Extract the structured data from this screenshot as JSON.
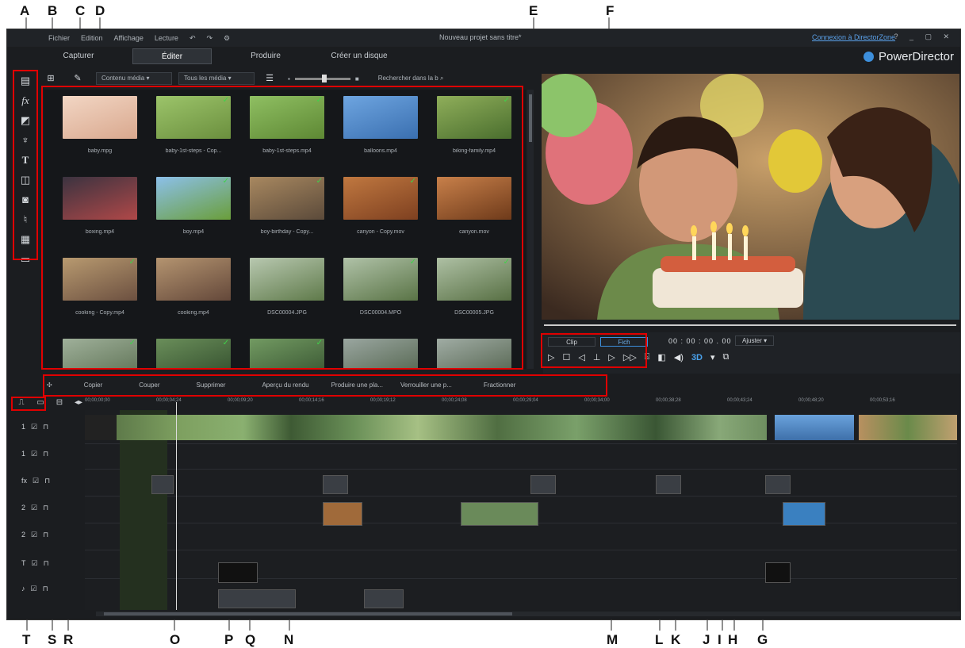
{
  "annotations_top": [
    "A",
    "B",
    "C",
    "D",
    "E",
    "F"
  ],
  "annotations_bottom": [
    "T",
    "S",
    "R",
    "O",
    "P",
    "Q",
    "N",
    "M",
    "L",
    "K",
    "J",
    "I",
    "H",
    "G"
  ],
  "menu": [
    "Fichier",
    "Edition",
    "Affichage",
    "Lecture"
  ],
  "project_title": "Nouveau projet sans titre*",
  "directorzone_link": "Connexion à DirectorZone",
  "window_controls": "? _ ▢ ✕",
  "mode_tabs": [
    "Capturer",
    "Éditer",
    "Produire",
    "Créer un disque"
  ],
  "brand": "PowerDirector",
  "library_bar": {
    "filter1": "Contenu média",
    "filter2": "Tous les média",
    "search_placeholder": "Rechercher dans la b"
  },
  "library_items": [
    {
      "name": "baby.mpg",
      "c1": "#f2d6c4",
      "c2": "#d9a88e",
      "check": false
    },
    {
      "name": "baby-1st-steps - Cop...",
      "c1": "#9cc46a",
      "c2": "#6b8f3e",
      "check": true
    },
    {
      "name": "baby-1st-steps.mp4",
      "c1": "#8fbf62",
      "c2": "#5e8834",
      "check": true
    },
    {
      "name": "balloons.mp4",
      "c1": "#6ea5e0",
      "c2": "#3a6fb0",
      "check": false
    },
    {
      "name": "biking-family.mp4",
      "c1": "#8fae5a",
      "c2": "#4a6e2e",
      "check": true
    },
    {
      "name": "boxing.mp4",
      "c1": "#3b3340",
      "c2": "#b04848",
      "check": false
    },
    {
      "name": "boy.mp4",
      "c1": "#8cc0ea",
      "c2": "#6a9e3a",
      "check": true
    },
    {
      "name": "boy-birthday - Copy...",
      "c1": "#a88860",
      "c2": "#5b4a3a",
      "check": true
    },
    {
      "name": "canyon - Copy.mov",
      "c1": "#c07840",
      "c2": "#7e4020",
      "check": true
    },
    {
      "name": "canyon.mov",
      "c1": "#c8804a",
      "c2": "#6e3a1a",
      "check": false
    },
    {
      "name": "cooking - Copy.mp4",
      "c1": "#b89a70",
      "c2": "#6c5040",
      "check": true
    },
    {
      "name": "cooking.mp4",
      "c1": "#b49470",
      "c2": "#64483a",
      "check": false
    },
    {
      "name": "DSC00004.JPG",
      "c1": "#b8c8b0",
      "c2": "#5f7a4a",
      "check": false
    },
    {
      "name": "DSC00004.MPO",
      "c1": "#b0c2a8",
      "c2": "#5a7446",
      "check": true
    },
    {
      "name": "DSC00005.JPG",
      "c1": "#aec0a4",
      "c2": "#587044",
      "check": true
    },
    {
      "name": "",
      "c1": "#9fb09a",
      "c2": "#5a6e50",
      "check": true
    },
    {
      "name": "",
      "c1": "#6a8e5a",
      "c2": "#2f4a2a",
      "check": true
    },
    {
      "name": "",
      "c1": "#729a62",
      "c2": "#34502e",
      "check": true
    },
    {
      "name": "",
      "c1": "#9aa6a0",
      "c2": "#4e6048",
      "check": false
    },
    {
      "name": "",
      "c1": "#a0aca4",
      "c2": "#4e5e48",
      "check": false
    }
  ],
  "player": {
    "clip_label": "Clip",
    "file_label": "Fich",
    "timecode": "00 : 00 : 00 . 00",
    "fit": "Ajuster"
  },
  "edit_toolbar": [
    "Copier",
    "Couper",
    "Supprimer",
    "Aperçu du rendu",
    "Produire une pla...",
    "Verrouiller une p...",
    "Fractionner"
  ],
  "ruler_ticks": [
    "00;00;00;00",
    "00;00;04;24",
    "00;00;09;20",
    "00;00;14;16",
    "00;00;19;12",
    "00;00;24;08",
    "00;00;29;04",
    "00;00;34;00",
    "00;00;38;28",
    "00;00;43;24",
    "00;00;48;20",
    "00;00;53;16"
  ],
  "track_labels": [
    "1",
    "1",
    "fx",
    "2",
    "2",
    "T",
    "♪"
  ]
}
